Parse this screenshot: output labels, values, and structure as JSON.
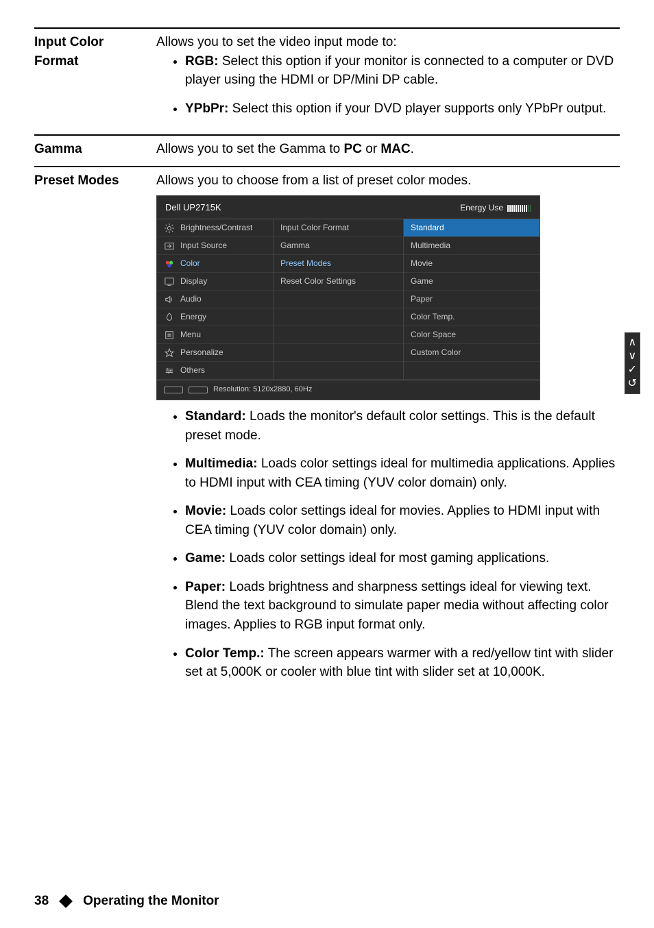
{
  "rows": {
    "inputColorFormat": {
      "term1": "Input Color",
      "term2": "Format",
      "lead": "Allows you to set the video input mode to:",
      "items": [
        {
          "label": "RGB:",
          "text": " Select this option if your monitor is connected to a computer or DVD player using the HDMI or DP/Mini DP cable."
        },
        {
          "label": "YPbPr:",
          "text": " Select this option if your DVD player supports only YPbPr output."
        }
      ]
    },
    "gamma": {
      "term": "Gamma",
      "pre": "Allows you to set the Gamma to ",
      "b1": "PC",
      "mid": " or ",
      "b2": "MAC",
      "post": "."
    },
    "presetModes": {
      "term": "Preset Modes",
      "lead": "Allows you to choose from a list of preset color modes.",
      "items": [
        {
          "label": "Standard:",
          "text": " Loads the monitor's default color settings. This is the default preset mode."
        },
        {
          "label": "Multimedia:",
          "text": " Loads color settings ideal for multimedia applications. Applies to HDMI input with CEA timing (YUV color domain) only."
        },
        {
          "label": "Movie:",
          "text": " Loads color settings ideal for movies. Applies to HDMI input with CEA timing (YUV color domain) only."
        },
        {
          "label": "Game:",
          "text": " Loads color settings ideal for most gaming applications."
        },
        {
          "label": "Paper:",
          "text": " Loads brightness and sharpness settings ideal for viewing text. Blend the text background to simulate paper media without affecting color images. Applies to RGB input format only."
        },
        {
          "label": "Color Temp.:",
          "text": " The screen appears warmer with a red/yellow tint with slider set at 5,000K or cooler with blue tint with slider set at 10,000K."
        }
      ]
    }
  },
  "osd": {
    "title": "Dell UP2715K",
    "energyLabel": "Energy Use",
    "menu": [
      {
        "label": "Brightness/Contrast",
        "icon": "sun"
      },
      {
        "label": "Input Source",
        "icon": "input"
      },
      {
        "label": "Color",
        "icon": "color",
        "active": true
      },
      {
        "label": "Display",
        "icon": "display"
      },
      {
        "label": "Audio",
        "icon": "audio"
      },
      {
        "label": "Energy",
        "icon": "energy"
      },
      {
        "label": "Menu",
        "icon": "menu"
      },
      {
        "label": "Personalize",
        "icon": "star"
      },
      {
        "label": "Others",
        "icon": "others"
      }
    ],
    "sub": [
      {
        "label": "Input Color Format"
      },
      {
        "label": "Gamma"
      },
      {
        "label": "Preset Modes",
        "selected": true
      },
      {
        "label": "Reset Color Settings"
      }
    ],
    "vals": [
      {
        "label": "Standard",
        "highlight": true
      },
      {
        "label": "Multimedia"
      },
      {
        "label": "Movie"
      },
      {
        "label": "Game"
      },
      {
        "label": "Paper"
      },
      {
        "label": "Color Temp."
      },
      {
        "label": "Color Space"
      },
      {
        "label": "Custom Color"
      }
    ],
    "footer": "Resolution: 5120x2880, 60Hz",
    "controls": [
      "∧",
      "∨",
      "✓",
      "↺"
    ]
  },
  "page": {
    "number": "38",
    "section": "Operating the Monitor"
  }
}
